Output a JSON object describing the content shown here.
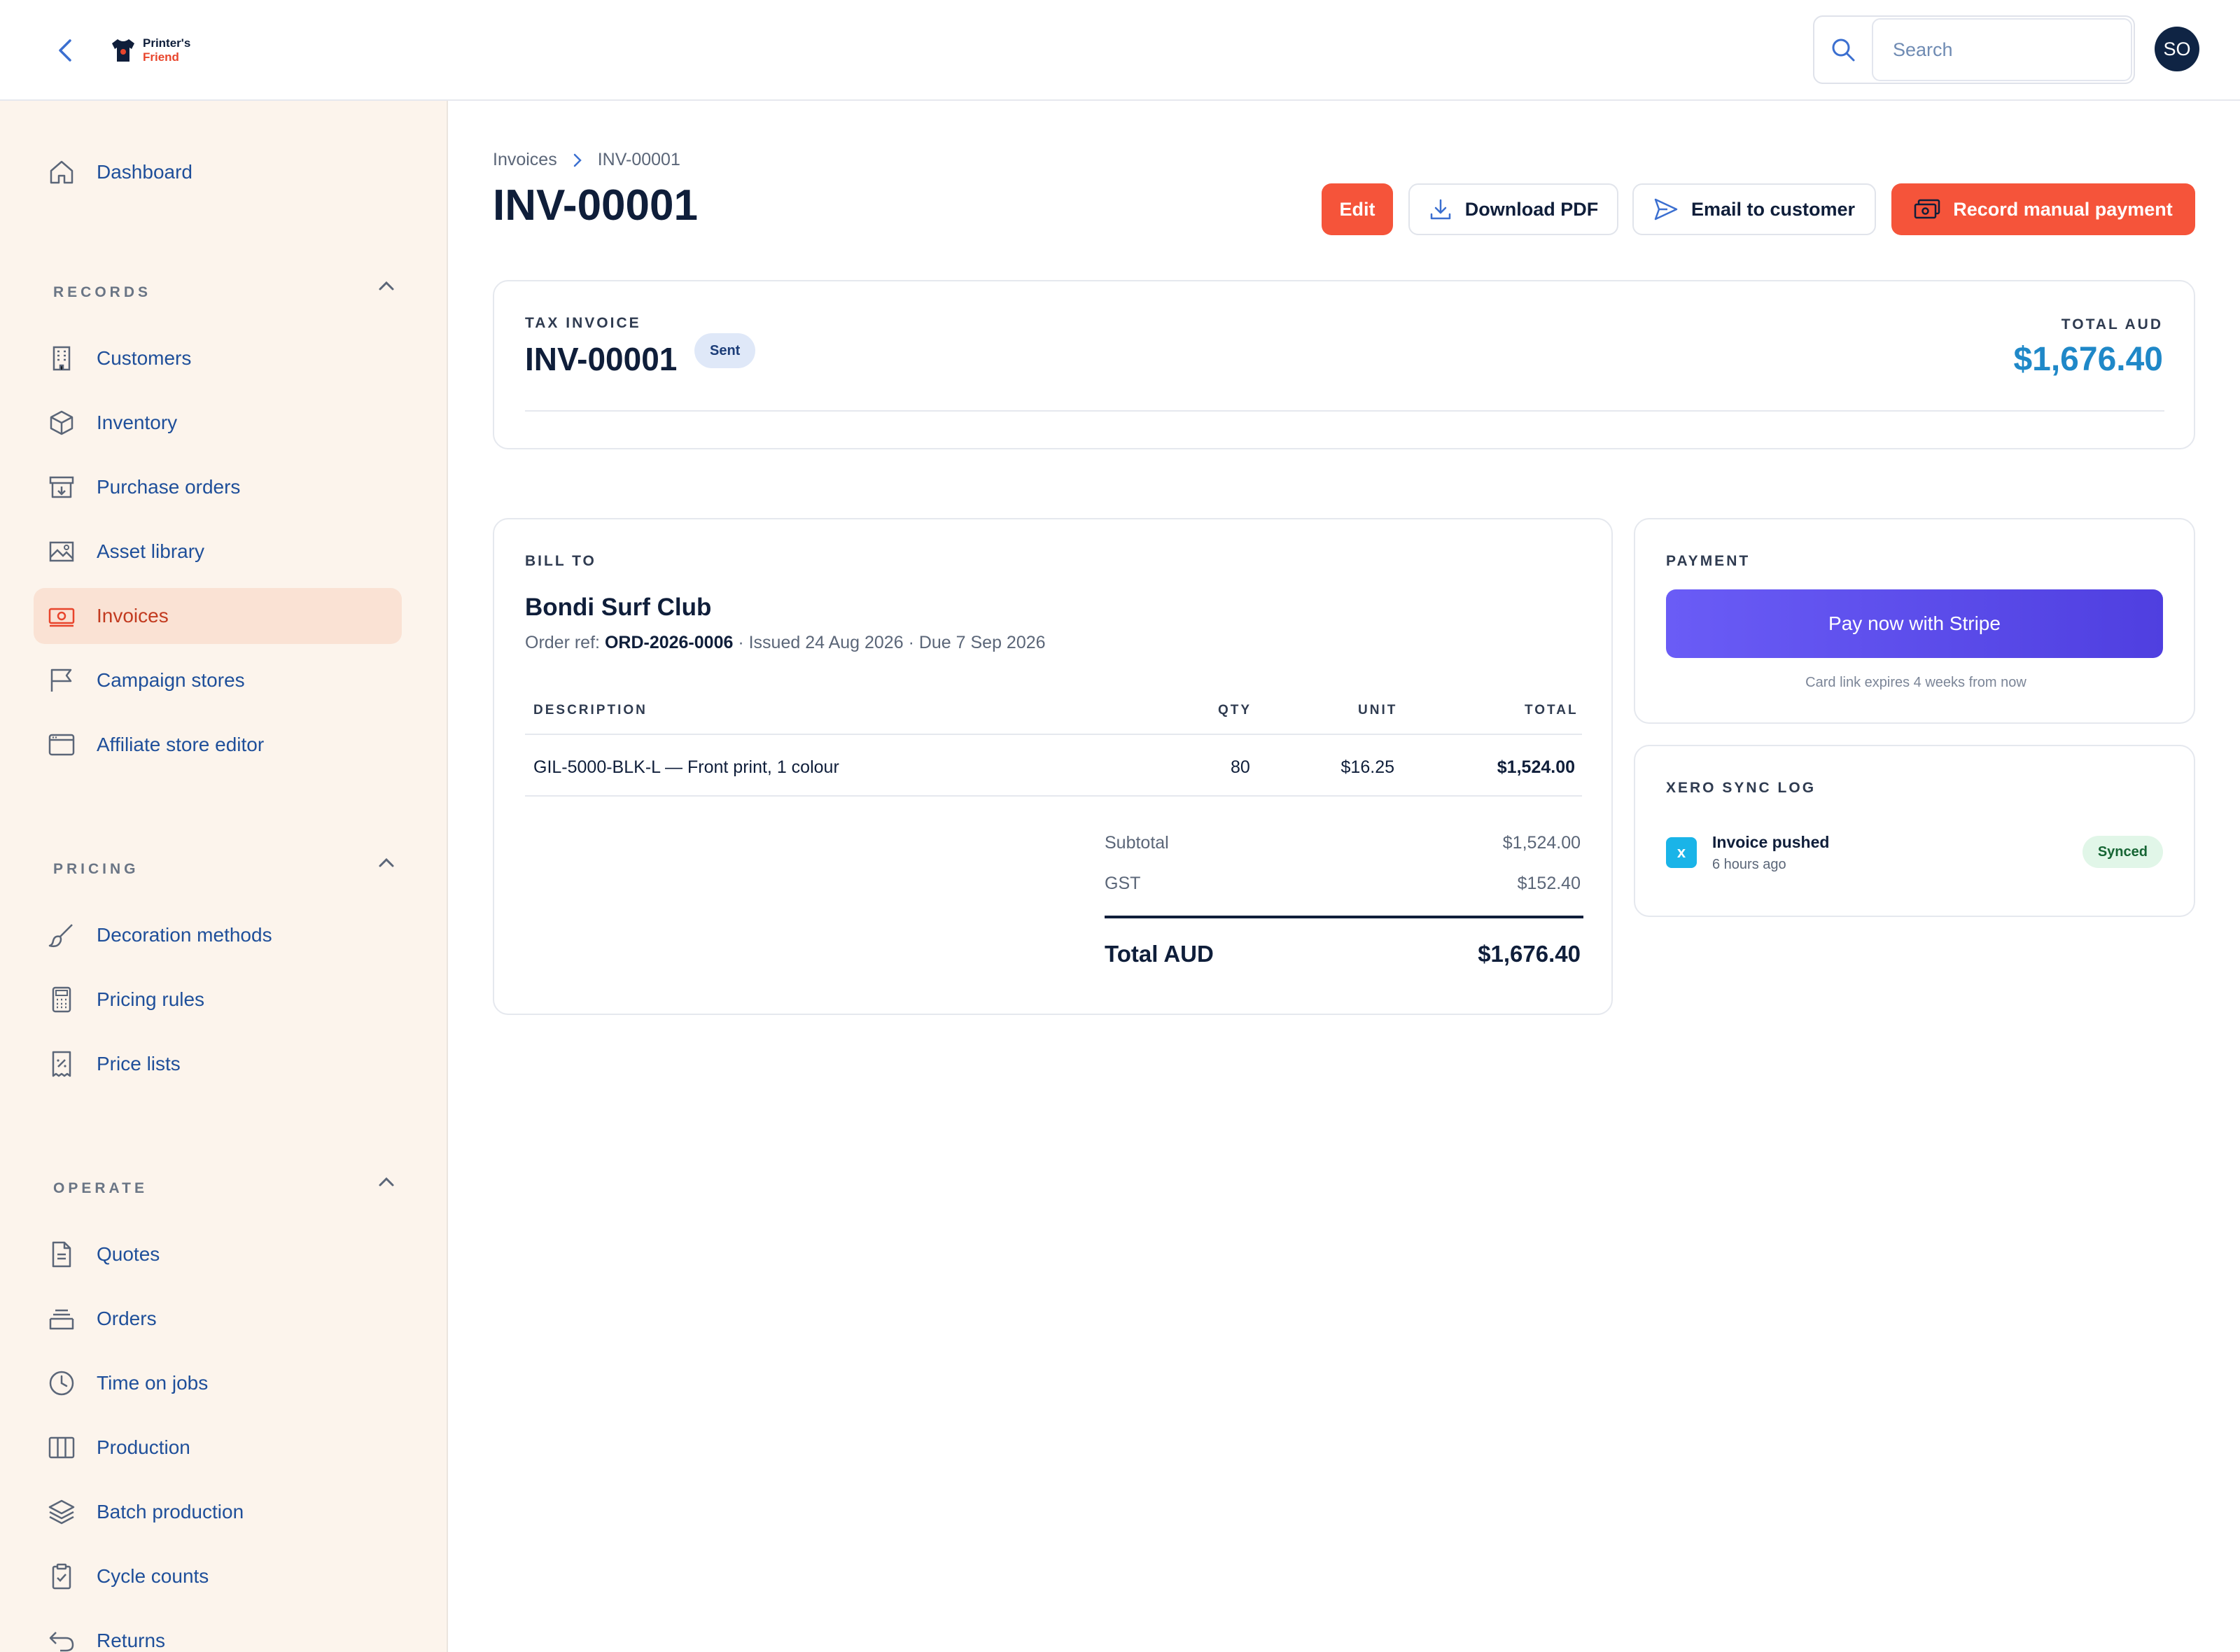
{
  "app": {
    "logo_line1": "Printer's",
    "logo_line2": "Friend",
    "avatar_initials": "SO"
  },
  "search": {
    "placeholder": "Search"
  },
  "sidebar": {
    "dashboard": "Dashboard",
    "sections": {
      "records": "RECORDS",
      "pricing": "PRICING",
      "operate": "OPERATE"
    },
    "records_items": [
      {
        "label": "Customers",
        "icon": "building-icon"
      },
      {
        "label": "Inventory",
        "icon": "box-icon"
      },
      {
        "label": "Purchase orders",
        "icon": "archive-icon"
      },
      {
        "label": "Asset library",
        "icon": "image-icon"
      },
      {
        "label": "Invoices",
        "icon": "banknote-icon",
        "active": true
      },
      {
        "label": "Campaign stores",
        "icon": "flag-icon"
      },
      {
        "label": "Affiliate store editor",
        "icon": "browser-icon"
      }
    ],
    "pricing_items": [
      {
        "label": "Decoration methods",
        "icon": "brush-icon"
      },
      {
        "label": "Pricing rules",
        "icon": "calculator-icon"
      },
      {
        "label": "Price lists",
        "icon": "receipt-icon"
      }
    ],
    "operate_items": [
      {
        "label": "Quotes",
        "icon": "document-icon"
      },
      {
        "label": "Orders",
        "icon": "inbox-icon"
      },
      {
        "label": "Time on jobs",
        "icon": "clock-icon"
      },
      {
        "label": "Production",
        "icon": "columns-icon"
      },
      {
        "label": "Batch production",
        "icon": "layers-icon"
      },
      {
        "label": "Cycle counts",
        "icon": "clipboard-check-icon"
      },
      {
        "label": "Returns",
        "icon": "undo-icon"
      }
    ]
  },
  "breadcrumb": {
    "parent": "Invoices",
    "current": "INV-00001"
  },
  "page": {
    "title": "INV-00001"
  },
  "actions": {
    "edit": "Edit",
    "download_pdf": "Download PDF",
    "email_customer": "Email to customer",
    "record_payment": "Record manual payment"
  },
  "invoice_header": {
    "type_label": "TAX INVOICE",
    "number": "INV-00001",
    "status": "Sent",
    "total_label": "TOTAL AUD",
    "total": "$1,676.40"
  },
  "bill_to": {
    "label": "BILL TO",
    "customer": "Bondi Surf Club",
    "order_ref_label": "Order ref:",
    "order_ref": "ORD-2026-0006",
    "dates": "· Issued 24 Aug 2026 · Due 7 Sep 2026"
  },
  "line_items": {
    "headers": {
      "description": "DESCRIPTION",
      "qty": "QTY",
      "unit": "UNIT",
      "total": "TOTAL"
    },
    "rows": [
      {
        "description": "GIL-5000-BLK-L — Front print, 1 colour",
        "qty": "80",
        "unit": "$16.25",
        "total": "$1,524.00"
      }
    ]
  },
  "summary": {
    "subtotal_label": "Subtotal",
    "subtotal": "$1,524.00",
    "gst_label": "GST",
    "gst": "$152.40",
    "total_label": "Total AUD",
    "total": "$1,676.40"
  },
  "payment": {
    "label": "PAYMENT",
    "stripe_button": "Pay now with Stripe",
    "note": "Card link expires 4 weeks from now"
  },
  "xero": {
    "label": "XERO SYNC LOG",
    "icon_letter": "x",
    "event": "Invoice pushed",
    "time": "6 hours ago",
    "status": "Synced"
  },
  "colors": {
    "accent": "#f5543a",
    "link": "#1f4f9a",
    "total_blue": "#1f88c8",
    "stripe": "#5b4cf0",
    "sidebar_bg": "#fcf4ec"
  }
}
